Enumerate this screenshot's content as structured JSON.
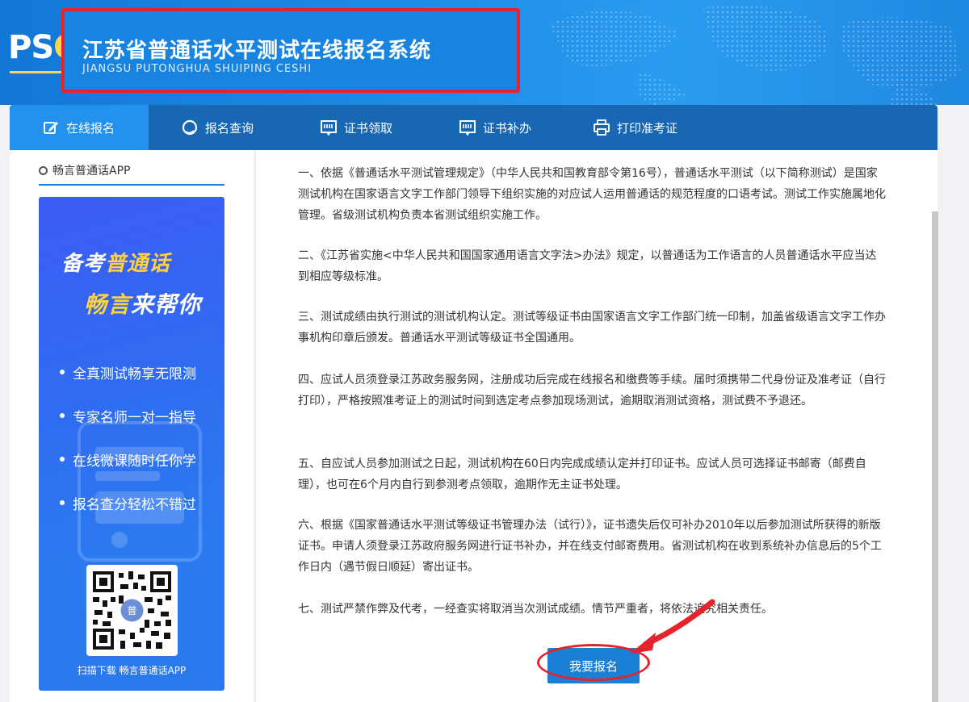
{
  "header": {
    "logo": "PSC",
    "title_cn": "江苏省普通话水平测试在线报名系统",
    "title_en": "JIANGSU PUTONGHUA SHUIPING CESHI"
  },
  "nav": {
    "items": [
      {
        "label": "在线报名",
        "icon": "edit-icon"
      },
      {
        "label": "报名查询",
        "icon": "search-icon"
      },
      {
        "label": "证书领取",
        "icon": "certificate-icon"
      },
      {
        "label": "证书补办",
        "icon": "certificate-icon"
      },
      {
        "label": "打印准考证",
        "icon": "printer-icon"
      }
    ],
    "active": 0
  },
  "side": {
    "heading": "畅言普通话APP",
    "banner": {
      "line1a": "备考",
      "line1b": "普通话",
      "line2a": "畅言",
      "line2b": "来帮你",
      "bullets": [
        "全真测试畅享无限测",
        "专家名师一对一指导",
        "在线微课随时任你学",
        "报名查分轻松不错过"
      ],
      "qr_caption": "扫描下载 畅言普通话APP"
    }
  },
  "main": {
    "paragraphs": [
      "一、依据《普通话水平测试管理规定》（中华人民共和国教育部令第16号），普通话水平测试（以下简称测试）是国家测试机构在国家语言文字工作部门领导下组织实施的对应试人运用普通话的规范程度的口语考试。测试工作实施属地化管理。省级测试机构负责本省测试组织实施工作。",
      "二、《江苏省实施<中华人民共和国国家通用语言文字法>办法》规定，以普通话为工作语言的人员普通话水平应当达到相应等级标准。",
      "三、测试成绩由执行测试的测试机构认定。测试等级证书由国家语言文字工作部门统一印制，加盖省级语言文字工作办事机构印章后颁发。普通话水平测试等级证书全国通用。",
      "四、应试人员须登录江苏政务服务网，注册成功后完成在线报名和缴费等手续。届时须携带二代身份证及准考证（自行打印），严格按照准考证上的测试时间到选定考点参加现场测试，逾期取消测试资格，测试费不予退还。",
      "五、自应试人员参加测试之日起，测试机构在60日内完成成绩认定并打印证书。应试人员可选择证书邮寄（邮费自理），也可在6个月内自行到参测考点领取，逾期作无主证书处理。",
      "六、根据《国家普通话水平测试等级证书管理办法（试行）》，证书遗失后仅可补办2010年以后参加测试所获得的新版证书。申请人须登录江苏政府服务网进行证书补办，并在线支付邮寄费用。省测试机构在收到系统补办信息后的5个工作日内（遇节假日顺延）寄出证书。",
      "七、测试严禁作弊及代考，一经查实将取消当次测试成绩。情节严重者，将依法追究相关责任。"
    ],
    "register_button": "我要报名"
  },
  "colors": {
    "header_blue": "#1e8de6",
    "nav_blue": "#1767b3",
    "nav_active": "#2292ee",
    "button_blue": "#1a80d6",
    "annotation_red": "#e5232b",
    "highlight_yellow": "#ffd23f"
  }
}
